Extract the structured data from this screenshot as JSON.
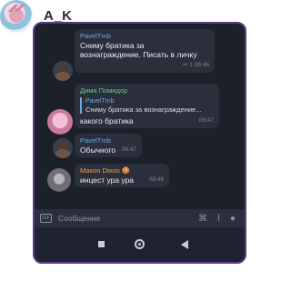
{
  "header": {
    "title": "A_K"
  },
  "messages": [
    {
      "author": "PavelTmb",
      "text_line1": "Сниму братика за",
      "text_line2": "вознаграждение. Писать в личку",
      "meta": "↩ 1 08:46"
    },
    {
      "author": "Дима Помидор",
      "reply_name": "PavelTmb",
      "reply_text": "Сниму братика за вознаграждение...",
      "text": "какого братика",
      "time": "08:47"
    },
    {
      "author": "PavelTmb",
      "text": "Обычного",
      "time": "08:47"
    },
    {
      "author": "Maxon Dixon",
      "author_emoji": "🍪",
      "text": "инцест ура ура",
      "time": "08:49"
    }
  ],
  "input": {
    "placeholder": "Сообщение"
  },
  "icons": {
    "gif": "GIF",
    "command": "command-icon",
    "attach": "paperclip-icon",
    "mic": "microphone-icon"
  },
  "colors": {
    "frame": "#5a3d86",
    "chat_bg": "#1c2029",
    "bubble": "#2a2f3b",
    "link_blue": "#6ca9df",
    "name_green": "#6ec98f",
    "name_orange": "#e7a85c"
  }
}
